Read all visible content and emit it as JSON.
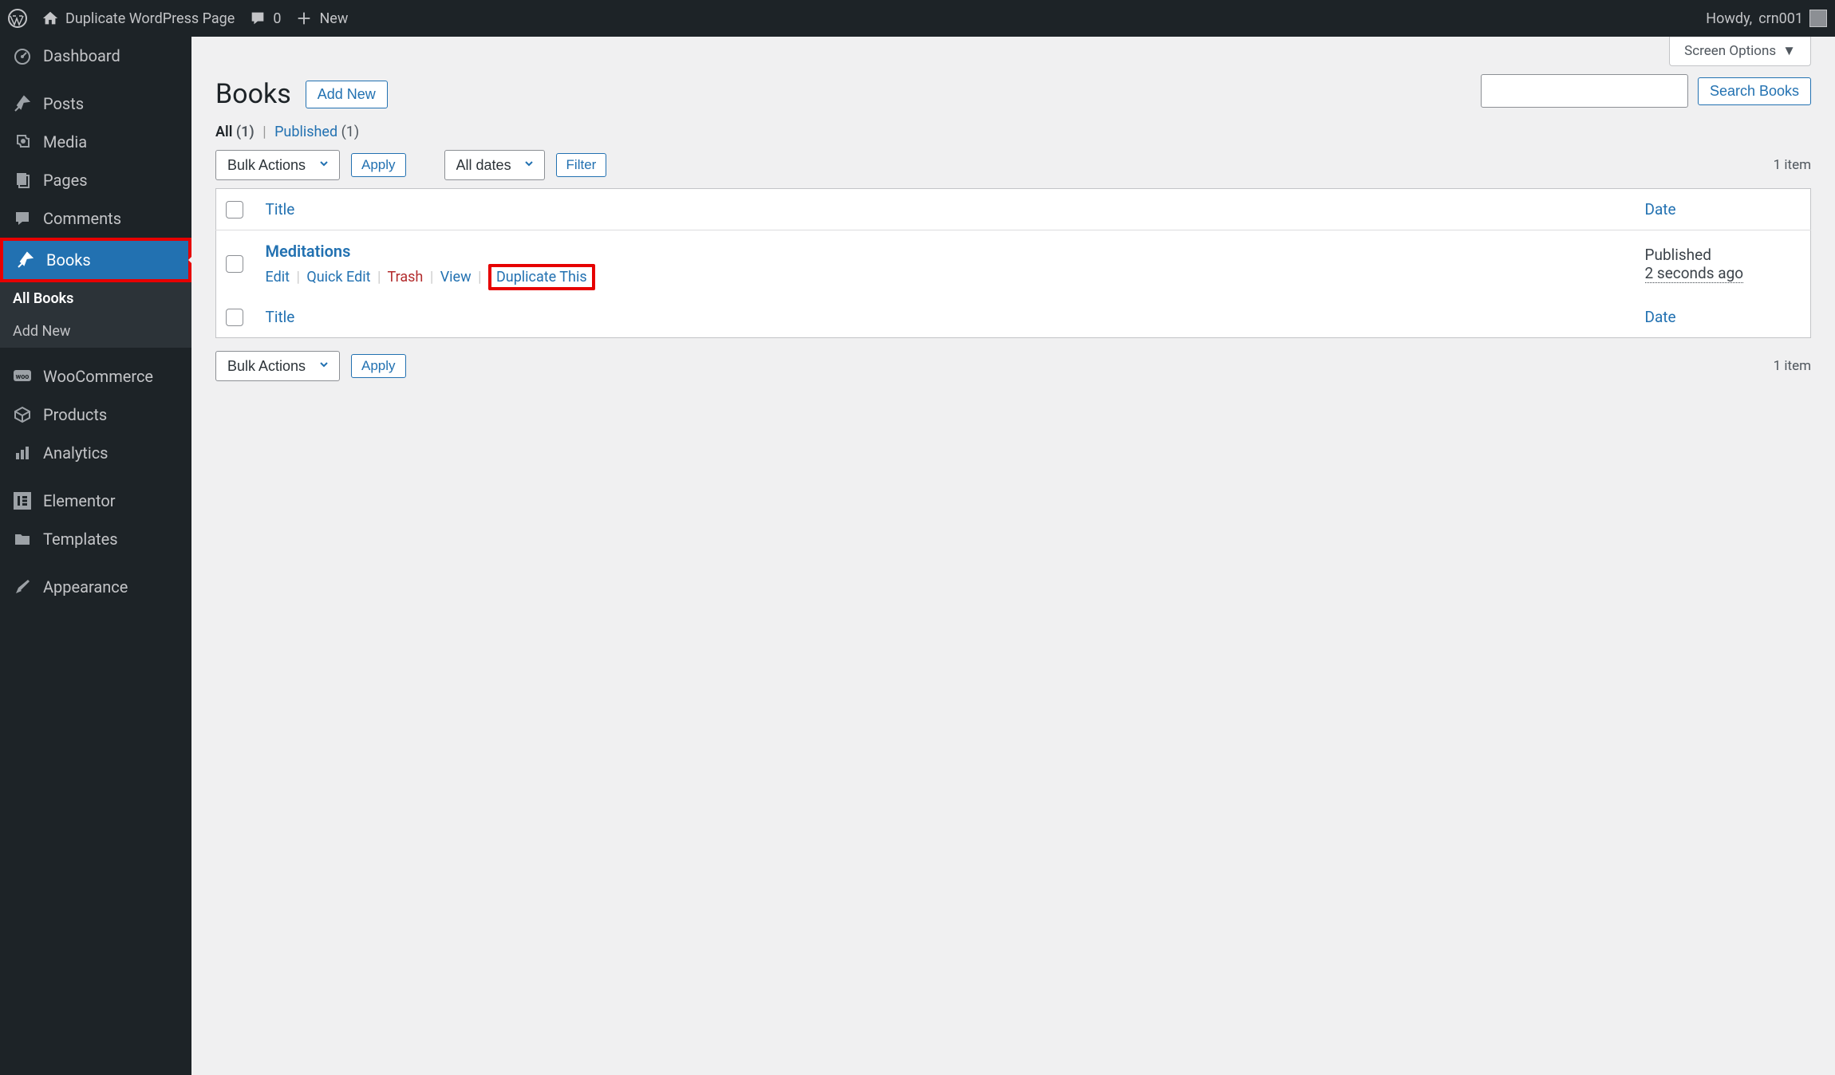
{
  "adminbar": {
    "site_title": "Duplicate WordPress Page",
    "comment_count": "0",
    "new_label": "New",
    "howdy": "Howdy,",
    "username": "crn001"
  },
  "sidebar": {
    "items": [
      {
        "label": "Dashboard",
        "icon": "dashboard"
      },
      {
        "label": "Posts",
        "icon": "pin"
      },
      {
        "label": "Media",
        "icon": "media"
      },
      {
        "label": "Pages",
        "icon": "pages"
      },
      {
        "label": "Comments",
        "icon": "comment"
      },
      {
        "label": "Books",
        "icon": "pin",
        "active": true
      },
      {
        "label": "WooCommerce",
        "icon": "woo"
      },
      {
        "label": "Products",
        "icon": "products"
      },
      {
        "label": "Analytics",
        "icon": "analytics"
      },
      {
        "label": "Elementor",
        "icon": "elementor"
      },
      {
        "label": "Templates",
        "icon": "templates"
      },
      {
        "label": "Appearance",
        "icon": "appearance"
      }
    ],
    "submenu": [
      {
        "label": "All Books",
        "current": true
      },
      {
        "label": "Add New"
      }
    ]
  },
  "screen_options_label": "Screen Options",
  "page": {
    "title": "Books",
    "add_new": "Add New"
  },
  "filters": {
    "all_label": "All",
    "all_count": "(1)",
    "published_label": "Published",
    "published_count": "(1)"
  },
  "search_button": "Search Books",
  "bulk_actions": "Bulk Actions",
  "apply_label": "Apply",
  "all_dates": "All dates",
  "filter_label": "Filter",
  "item_count": "1 item",
  "columns": {
    "title": "Title",
    "date": "Date"
  },
  "rows": [
    {
      "title": "Meditations",
      "status": "Published",
      "time": "2 seconds ago",
      "actions": {
        "edit": "Edit",
        "quick_edit": "Quick Edit",
        "trash": "Trash",
        "view": "View",
        "duplicate": "Duplicate This"
      }
    }
  ]
}
